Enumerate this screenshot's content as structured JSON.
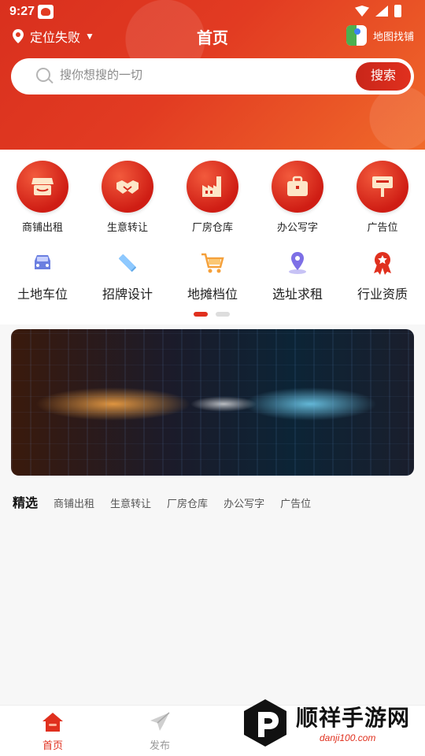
{
  "status_bar": {
    "time": "9:27"
  },
  "header": {
    "location_label": "定位失败",
    "title": "首页",
    "map_find_label": "地图找铺"
  },
  "search": {
    "placeholder": "搜你想搜的一切",
    "button_label": "搜索"
  },
  "categories_primary": [
    {
      "label": "商铺出租",
      "icon": "storefront-icon"
    },
    {
      "label": "生意转让",
      "icon": "handshake-icon"
    },
    {
      "label": "厂房仓库",
      "icon": "factory-icon"
    },
    {
      "label": "办公写字",
      "icon": "briefcase-icon"
    },
    {
      "label": "广告位",
      "icon": "billboard-icon"
    }
  ],
  "categories_secondary": [
    {
      "label": "土地车位",
      "icon": "car-icon"
    },
    {
      "label": "招牌设计",
      "icon": "ruler-pencil-icon"
    },
    {
      "label": "地摊档位",
      "icon": "cart-icon"
    },
    {
      "label": "选址求租",
      "icon": "location-pin-icon"
    },
    {
      "label": "行业资质",
      "icon": "award-ribbon-icon"
    }
  ],
  "carousel": {
    "pages": 2,
    "active": 0
  },
  "tabs": {
    "main": "精选",
    "items": [
      "商铺出租",
      "生意转让",
      "厂房仓库",
      "办公写字",
      "广告位"
    ]
  },
  "bottom_nav": {
    "home_label": "首页",
    "post_label": "发布"
  },
  "watermark": {
    "title": "顺祥手游网",
    "sub": "danji100.com"
  },
  "colors": {
    "brand_red": "#e0301e",
    "gradient_end": "#f06a2a"
  }
}
